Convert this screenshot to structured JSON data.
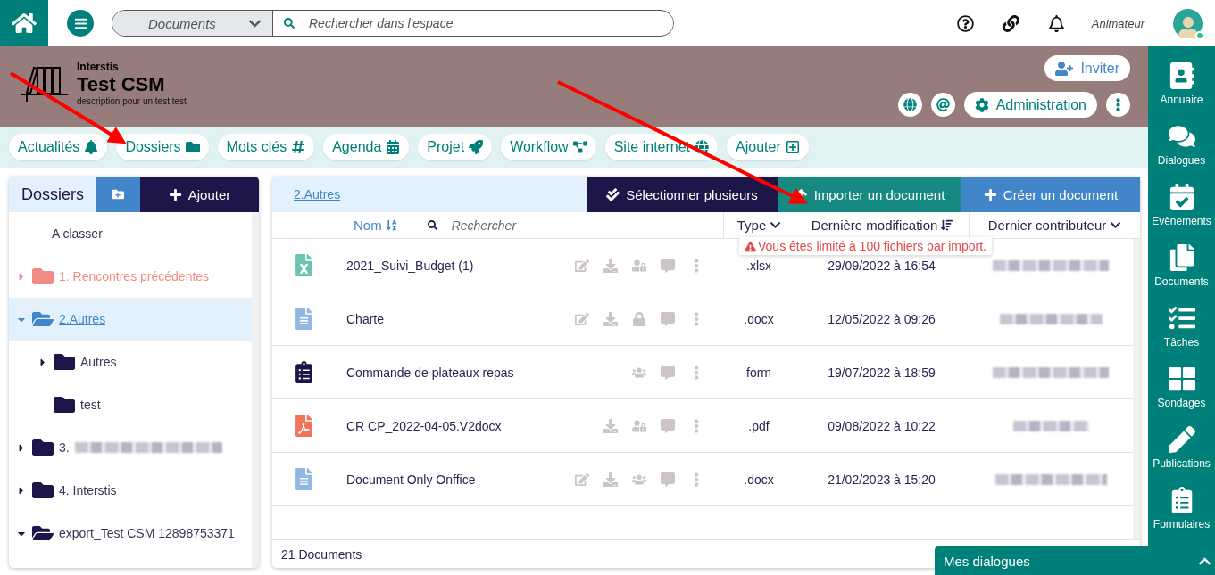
{
  "top_bar": {
    "scope": "Documents",
    "search": {
      "placeholder": "Rechercher dans l'espace"
    },
    "user": {
      "role": "Animateur",
      "online": true
    }
  },
  "banner": {
    "organization": "Interstis",
    "title": "Test CSM",
    "description": "description pour un test test",
    "invite": "Inviter",
    "admin": "Administration"
  },
  "nav_tabs": [
    {
      "label": "Actualités"
    },
    {
      "label": "Dossiers"
    },
    {
      "label": "Mots clés"
    },
    {
      "label": "Agenda"
    },
    {
      "label": "Projet"
    },
    {
      "label": "Workflow"
    },
    {
      "label": "Site internet"
    },
    {
      "label": "Ajouter"
    }
  ],
  "folders_panel": {
    "title": "Dossiers",
    "add": "Ajouter",
    "tree": [
      {
        "label": "A classer",
        "kind": "plain",
        "selected": false
      },
      {
        "label": "1. Rencontres précédentes",
        "kind": "folder",
        "color": "#f28b85",
        "expanded": false,
        "selected": false
      },
      {
        "label": "2.Autres",
        "kind": "folder",
        "expanded": true,
        "selected": true,
        "children": [
          {
            "label": "Autres",
            "kind": "folder",
            "expanded": false,
            "selected": false
          },
          {
            "label": "test",
            "kind": "folder",
            "selected": false
          }
        ]
      },
      {
        "label": "3.",
        "kind": "folder",
        "blurred": true,
        "expanded": false,
        "selected": false
      },
      {
        "label": "4. Interstis",
        "kind": "folder",
        "expanded": false,
        "selected": false
      },
      {
        "label": "export_Test CSM 12898753371",
        "kind": "folder",
        "expanded": true,
        "selected": false
      }
    ]
  },
  "documents_panel": {
    "breadcrumb": "2.Autres",
    "buttons": [
      {
        "label": "Sélectionner plusieurs",
        "kind": "select"
      },
      {
        "label": "Importer un document",
        "kind": "import"
      },
      {
        "label": "Créer un document",
        "kind": "create"
      }
    ],
    "columns": [
      {
        "label": "Nom",
        "kind": "sort"
      },
      {
        "label": "Type",
        "kind": "chevron"
      },
      {
        "label": "Dernière modification",
        "kind": "sort"
      },
      {
        "label": "Dernier contributeur",
        "kind": "chevron"
      }
    ],
    "search": {
      "placeholder": "Rechercher"
    },
    "tooltip": "Vous êtes limité à 100 fichiers par import.",
    "rows": [
      {
        "name": "2021_Suivi_Budget (1)",
        "kind": "sheet",
        "actions": [
          {
            "kind": "edit"
          },
          {
            "kind": "download"
          },
          {
            "kind": "user-lock"
          },
          {
            "kind": "comment"
          },
          {
            "kind": "more"
          }
        ],
        "type": ".xlsx",
        "modified": "29/09/2022 à 16:54",
        "contributor": {
          "blurred": true
        }
      },
      {
        "name": "Charte",
        "kind": "doc",
        "actions": [
          {
            "kind": "edit"
          },
          {
            "kind": "download"
          },
          {
            "kind": "lock"
          },
          {
            "kind": "comment"
          },
          {
            "kind": "more"
          }
        ],
        "type": ".docx",
        "modified": "12/05/2022 à 09:26",
        "contributor": {
          "blurred": true
        }
      },
      {
        "name": "Commande de plateaux repas",
        "kind": "form",
        "actions": [
          {
            "kind": "users"
          },
          {
            "kind": "comment"
          },
          {
            "kind": "more"
          }
        ],
        "type": "form",
        "modified": "19/07/2022 à 18:59",
        "contributor": {
          "blurred": true
        }
      },
      {
        "name": "CR CP_2022-04-05.V2docx",
        "kind": "pdf",
        "actions": [
          {
            "kind": "download"
          },
          {
            "kind": "user-lock"
          },
          {
            "kind": "comment"
          },
          {
            "kind": "more"
          }
        ],
        "type": ".pdf",
        "modified": "09/08/2022 à 10:22",
        "contributor": {
          "blurred": true
        }
      },
      {
        "name": "Document Only Onffice",
        "kind": "doc",
        "actions": [
          {
            "kind": "edit"
          },
          {
            "kind": "download"
          },
          {
            "kind": "users"
          },
          {
            "kind": "comment"
          },
          {
            "kind": "more"
          }
        ],
        "type": ".docx",
        "modified": "21/02/2023 à 15:20",
        "contributor": {
          "blurred": true
        }
      }
    ],
    "count": "21 Documents"
  },
  "side_menu": [
    {
      "label": "Annuaire"
    },
    {
      "label": "Dialogues"
    },
    {
      "label": "Evènements"
    },
    {
      "label": "Documents"
    },
    {
      "label": "Tâches"
    },
    {
      "label": "Sondages"
    },
    {
      "label": "Publications"
    },
    {
      "label": "Formulaires"
    }
  ],
  "chat_bar": {
    "label": "Mes dialogues"
  },
  "annotations": [
    {
      "kind": "arrow",
      "color": "#ff0000"
    },
    {
      "kind": "arrow",
      "color": "#ff0000"
    }
  ]
}
